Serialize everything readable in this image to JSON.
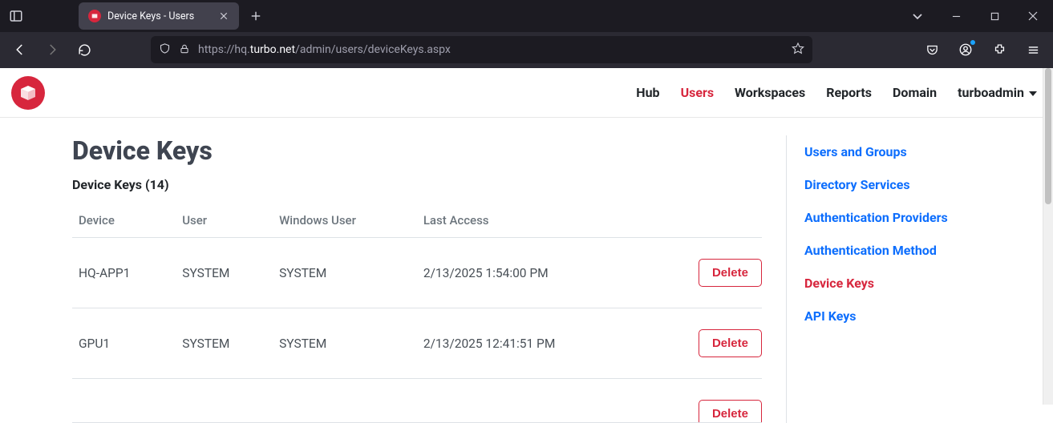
{
  "browser": {
    "tab_title": "Device Keys - Users",
    "url_prefix": "https://hq.",
    "url_host": "turbo.net",
    "url_path": "/admin/users/deviceKeys.aspx"
  },
  "nav": {
    "items": [
      "Hub",
      "Users",
      "Workspaces",
      "Reports",
      "Domain"
    ],
    "active": "Users",
    "user": "turboadmin"
  },
  "page": {
    "title": "Device Keys",
    "subtitle": "Device Keys (14)",
    "columns": [
      "Device",
      "User",
      "Windows User",
      "Last Access"
    ],
    "rows": [
      {
        "device": "HQ-APP1",
        "user": "SYSTEM",
        "wuser": "SYSTEM",
        "last": "2/13/2025 1:54:00 PM",
        "action": "Delete"
      },
      {
        "device": "GPU1",
        "user": "SYSTEM",
        "wuser": "SYSTEM",
        "last": "2/13/2025 12:41:51 PM",
        "action": "Delete"
      }
    ],
    "partial_action": "Delete"
  },
  "sidebar": {
    "items": [
      "Users and Groups",
      "Directory Services",
      "Authentication Providers",
      "Authentication Method",
      "Device Keys",
      "API Keys"
    ],
    "active": "Device Keys"
  }
}
